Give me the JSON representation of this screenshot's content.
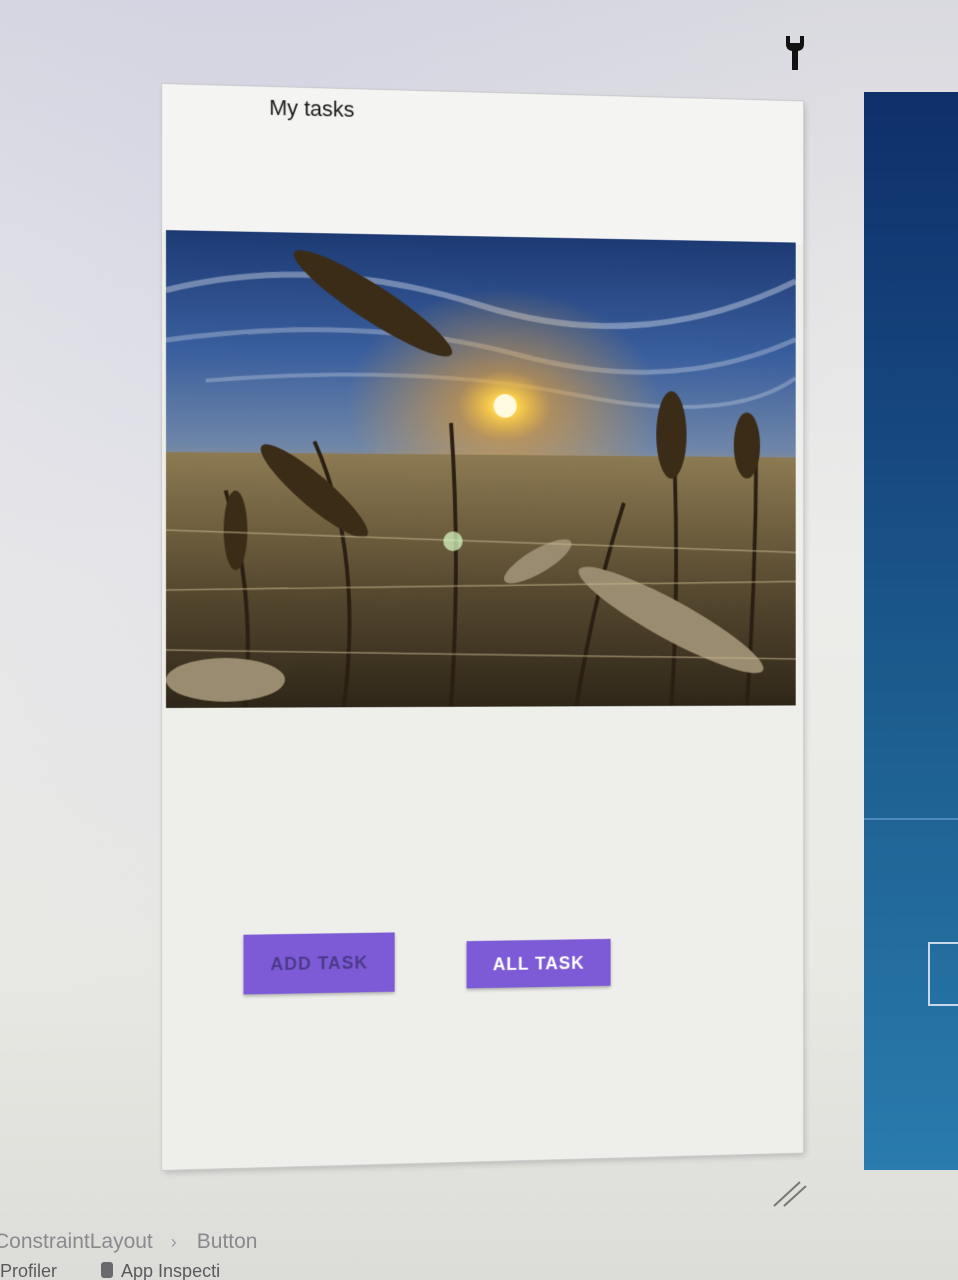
{
  "preview": {
    "title": "My tasks",
    "buttons": {
      "add_task": "ADD TASK",
      "all_task": "ALL TASK"
    }
  },
  "breadcrumb": {
    "items": [
      "ConstraintLayout",
      "Button"
    ]
  },
  "bottom_toolbar": {
    "tabs": [
      "Profiler",
      "App Inspecti"
    ]
  },
  "colors": {
    "button": "#7e5bd6",
    "device_background": "#eeeeea",
    "blueprint": "#16467e"
  },
  "icons": {
    "top_right": "wrench-icon",
    "corner": "resize-handle-icon",
    "separator": "chevron-right-icon"
  }
}
